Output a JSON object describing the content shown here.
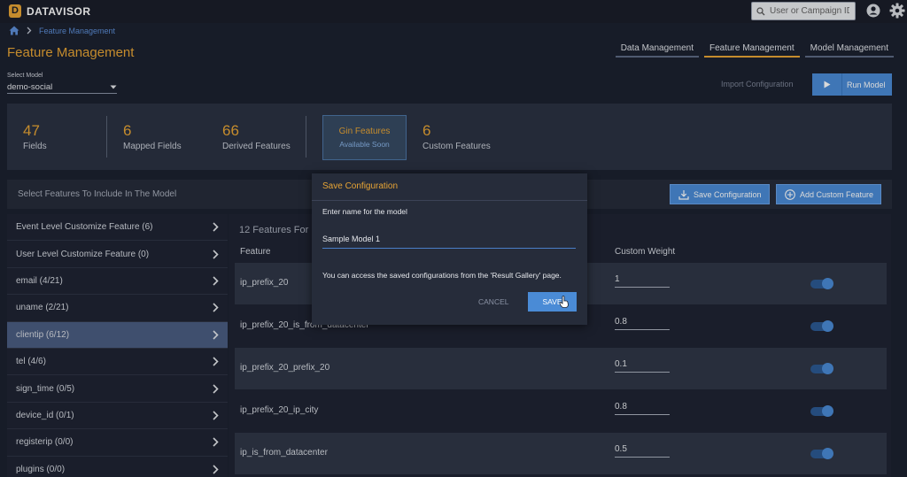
{
  "app": {
    "brand": "DATAVISOR",
    "logo_letter": "D"
  },
  "header": {
    "search_placeholder": "User or Campaign ID"
  },
  "breadcrumb": {
    "current": "Feature Management"
  },
  "page": {
    "title": "Feature Management"
  },
  "nav_tabs": [
    {
      "label": "Data Management",
      "active": false
    },
    {
      "label": "Feature Management",
      "active": true
    },
    {
      "label": "Model Management",
      "active": false
    }
  ],
  "model_select": {
    "label": "Select Model",
    "value": "demo-social"
  },
  "actions": {
    "import_label": "Import Configuration",
    "run_label": "Run Model"
  },
  "stats": {
    "fields": {
      "value": "47",
      "label": "Fields"
    },
    "mapped": {
      "value": "6",
      "label": "Mapped Fields"
    },
    "derived": {
      "value": "66",
      "label": "Derived Features"
    },
    "gin": {
      "title": "Gin Features",
      "subtitle": "Available Soon"
    },
    "custom": {
      "value": "6",
      "label": "Custom Features"
    }
  },
  "select_bar": {
    "title": "Select Features To Include In The Model",
    "save_label": "Save Configuration",
    "add_label": "Add Custom Feature"
  },
  "feature_groups": [
    {
      "label": "Event Level Customize Feature (6)",
      "active": false
    },
    {
      "label": "User Level Customize Feature (0)",
      "active": false
    },
    {
      "label": "email (4/21)",
      "active": false
    },
    {
      "label": "uname (2/21)",
      "active": false
    },
    {
      "label": "clientip (6/12)",
      "active": true
    },
    {
      "label": "tel (4/6)",
      "active": false
    },
    {
      "label": "sign_time (0/5)",
      "active": false
    },
    {
      "label": "device_id (0/1)",
      "active": false
    },
    {
      "label": "registerip (0/0)",
      "active": false
    },
    {
      "label": "plugins (0/0)",
      "active": false
    }
  ],
  "table": {
    "count_label": "12 Features For",
    "col_feature": "Feature",
    "col_weight": "Custom Weight",
    "rows": [
      {
        "feature": "ip_prefix_20",
        "weight": "1",
        "enabled": true
      },
      {
        "feature": "ip_prefix_20_is_from_datacenter",
        "weight": "0.8",
        "enabled": true
      },
      {
        "feature": "ip_prefix_20_prefix_20",
        "weight": "0.1",
        "enabled": true
      },
      {
        "feature": "ip_prefix_20_ip_city",
        "weight": "0.8",
        "enabled": true
      },
      {
        "feature": "ip_is_from_datacenter",
        "weight": "0.5",
        "enabled": true
      }
    ]
  },
  "modal": {
    "title": "Save Configuration",
    "label": "Enter name for the model",
    "input_value": "Sample Model 1",
    "note": "You can access the saved configurations from the 'Result Gallery' page.",
    "cancel_label": "CANCEL",
    "save_label": "SAVE"
  },
  "colors": {
    "accent": "#e8a535",
    "primary": "#4a8bd6",
    "background": "#1c2130",
    "panel": "#2b3242"
  }
}
